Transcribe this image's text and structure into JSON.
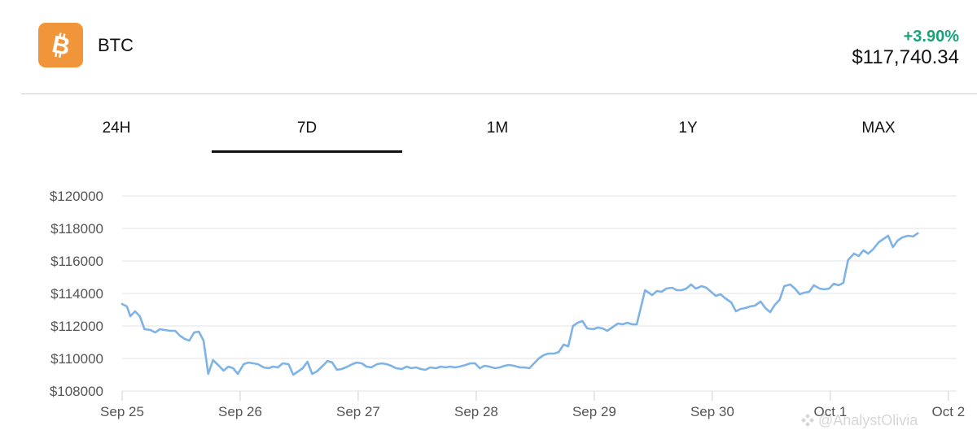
{
  "coin": {
    "symbol": "BTC",
    "icon": "bitcoin-icon",
    "icon_color": "#f0953a"
  },
  "quote": {
    "change": "+3.90%",
    "change_color": "#1aa37a",
    "price": "$117,740.34"
  },
  "tabs": [
    {
      "label": "24H",
      "active": false
    },
    {
      "label": "7D",
      "active": true
    },
    {
      "label": "1M",
      "active": false
    },
    {
      "label": "1Y",
      "active": false
    },
    {
      "label": "MAX",
      "active": false
    }
  ],
  "watermark": "@AnalystOlivia",
  "chart_data": {
    "type": "line",
    "title": "",
    "xlabel": "",
    "ylabel": "",
    "ylim": [
      108000,
      120000
    ],
    "yticks": [
      108000,
      110000,
      112000,
      114000,
      116000,
      118000,
      120000
    ],
    "ytick_prefix": "$",
    "xlim": [
      0,
      7.07
    ],
    "xticks": [
      {
        "x": 0,
        "label": "Sep 25"
      },
      {
        "x": 1,
        "label": "Sep 26"
      },
      {
        "x": 2,
        "label": "Sep 27"
      },
      {
        "x": 3,
        "label": "Sep 28"
      },
      {
        "x": 4,
        "label": "Sep 29"
      },
      {
        "x": 5,
        "label": "Sep 30"
      },
      {
        "x": 6,
        "label": "Oct 1"
      },
      {
        "x": 7,
        "label": "Oct 2"
      }
    ],
    "grid": true,
    "line_color": "#7fb3e6",
    "series": [
      {
        "points": [
          [
            0,
            113350
          ],
          [
            0.04,
            113200
          ],
          [
            0.07,
            112600
          ],
          [
            0.11,
            112900
          ],
          [
            0.15,
            112600
          ],
          [
            0.19,
            111800
          ],
          [
            0.24,
            111750
          ],
          [
            0.28,
            111600
          ],
          [
            0.32,
            111800
          ],
          [
            0.36,
            111750
          ],
          [
            0.41,
            111700
          ],
          [
            0.45,
            111700
          ],
          [
            0.49,
            111400
          ],
          [
            0.53,
            111200
          ],
          [
            0.57,
            111100
          ],
          [
            0.61,
            111600
          ],
          [
            0.65,
            111650
          ],
          [
            0.69,
            111100
          ],
          [
            0.73,
            109050
          ],
          [
            0.77,
            109900
          ],
          [
            0.82,
            109550
          ],
          [
            0.86,
            109250
          ],
          [
            0.9,
            109500
          ],
          [
            0.94,
            109400
          ],
          [
            0.98,
            109050
          ],
          [
            1.03,
            109650
          ],
          [
            1.07,
            109750
          ],
          [
            1.11,
            109700
          ],
          [
            1.15,
            109650
          ],
          [
            1.2,
            109450
          ],
          [
            1.24,
            109400
          ],
          [
            1.28,
            109500
          ],
          [
            1.32,
            109450
          ],
          [
            1.36,
            109700
          ],
          [
            1.41,
            109650
          ],
          [
            1.45,
            109000
          ],
          [
            1.49,
            109200
          ],
          [
            1.53,
            109400
          ],
          [
            1.57,
            109800
          ],
          [
            1.61,
            109050
          ],
          [
            1.65,
            109200
          ],
          [
            1.7,
            109550
          ],
          [
            1.74,
            109850
          ],
          [
            1.78,
            109750
          ],
          [
            1.82,
            109300
          ],
          [
            1.86,
            109350
          ],
          [
            1.91,
            109500
          ],
          [
            1.95,
            109650
          ],
          [
            1.99,
            109750
          ],
          [
            2.03,
            109700
          ],
          [
            2.07,
            109500
          ],
          [
            2.11,
            109450
          ],
          [
            2.16,
            109650
          ],
          [
            2.2,
            109700
          ],
          [
            2.24,
            109650
          ],
          [
            2.28,
            109550
          ],
          [
            2.32,
            109400
          ],
          [
            2.37,
            109350
          ],
          [
            2.41,
            109500
          ],
          [
            2.45,
            109400
          ],
          [
            2.49,
            109450
          ],
          [
            2.53,
            109350
          ],
          [
            2.57,
            109300
          ],
          [
            2.61,
            109450
          ],
          [
            2.66,
            109400
          ],
          [
            2.7,
            109500
          ],
          [
            2.74,
            109450
          ],
          [
            2.78,
            109500
          ],
          [
            2.82,
            109450
          ],
          [
            2.86,
            109500
          ],
          [
            2.91,
            109600
          ],
          [
            2.95,
            109700
          ],
          [
            2.99,
            109700
          ],
          [
            3.03,
            109400
          ],
          [
            3.07,
            109550
          ],
          [
            3.11,
            109500
          ],
          [
            3.16,
            109400
          ],
          [
            3.2,
            109450
          ],
          [
            3.24,
            109550
          ],
          [
            3.28,
            109600
          ],
          [
            3.32,
            109550
          ],
          [
            3.37,
            109450
          ],
          [
            3.41,
            109450
          ],
          [
            3.45,
            109400
          ],
          [
            3.49,
            109700
          ],
          [
            3.53,
            110000
          ],
          [
            3.57,
            110200
          ],
          [
            3.61,
            110300
          ],
          [
            3.66,
            110300
          ],
          [
            3.7,
            110400
          ],
          [
            3.74,
            110850
          ],
          [
            3.78,
            110750
          ],
          [
            3.82,
            112000
          ],
          [
            3.86,
            112200
          ],
          [
            3.9,
            112300
          ],
          [
            3.94,
            111850
          ],
          [
            3.99,
            111800
          ],
          [
            4.03,
            111900
          ],
          [
            4.07,
            111850
          ],
          [
            4.11,
            111700
          ],
          [
            4.15,
            111900
          ],
          [
            4.2,
            112150
          ],
          [
            4.24,
            112100
          ],
          [
            4.28,
            112200
          ],
          [
            4.32,
            112100
          ],
          [
            4.36,
            112100
          ],
          [
            4.43,
            114200
          ],
          [
            4.49,
            113900
          ],
          [
            4.53,
            114150
          ],
          [
            4.57,
            114100
          ],
          [
            4.61,
            114300
          ],
          [
            4.66,
            114350
          ],
          [
            4.7,
            114200
          ],
          [
            4.74,
            114200
          ],
          [
            4.78,
            114300
          ],
          [
            4.82,
            114550
          ],
          [
            4.86,
            114300
          ],
          [
            4.91,
            114450
          ],
          [
            4.95,
            114350
          ],
          [
            4.99,
            114100
          ],
          [
            5.03,
            113850
          ],
          [
            5.07,
            113950
          ],
          [
            5.11,
            113700
          ],
          [
            5.16,
            113450
          ],
          [
            5.2,
            112900
          ],
          [
            5.24,
            113050
          ],
          [
            5.28,
            113100
          ],
          [
            5.32,
            113200
          ],
          [
            5.36,
            113250
          ],
          [
            5.41,
            113500
          ],
          [
            5.45,
            113100
          ],
          [
            5.49,
            112850
          ],
          [
            5.53,
            113300
          ],
          [
            5.57,
            113600
          ],
          [
            5.61,
            114450
          ],
          [
            5.66,
            114550
          ],
          [
            5.7,
            114300
          ],
          [
            5.74,
            113950
          ],
          [
            5.78,
            114050
          ],
          [
            5.82,
            114100
          ],
          [
            5.86,
            114500
          ],
          [
            5.91,
            114300
          ],
          [
            5.95,
            114250
          ],
          [
            5.99,
            114300
          ],
          [
            6.03,
            114600
          ],
          [
            6.07,
            114500
          ],
          [
            6.11,
            114650
          ],
          [
            6.15,
            116050
          ],
          [
            6.2,
            116450
          ],
          [
            6.24,
            116300
          ],
          [
            6.28,
            116650
          ],
          [
            6.32,
            116450
          ],
          [
            6.36,
            116700
          ],
          [
            6.41,
            117150
          ],
          [
            6.45,
            117350
          ],
          [
            6.49,
            117550
          ],
          [
            6.53,
            116850
          ],
          [
            6.57,
            117250
          ],
          [
            6.61,
            117450
          ],
          [
            6.66,
            117550
          ],
          [
            6.7,
            117500
          ],
          [
            6.74,
            117700
          ]
        ]
      }
    ]
  }
}
